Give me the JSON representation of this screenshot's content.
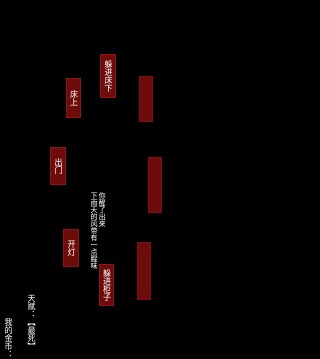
{
  "actions": {
    "drill_under_bed": "躲进床下",
    "go_to_bed": "床上",
    "go_out": "出门",
    "turn_on_light": "开灯",
    "drill_into_cabinet": "躲进柜子"
  },
  "message": {
    "line1": "你醒了出来",
    "line2": "下雨天的风带有一点腥味"
  },
  "stats": {
    "coins": "我的金币：",
    "talent": "天赋：【最死】"
  },
  "colors": {
    "button_bg": "#6e0b0b",
    "background": "#000000",
    "text": "#ffffff"
  }
}
